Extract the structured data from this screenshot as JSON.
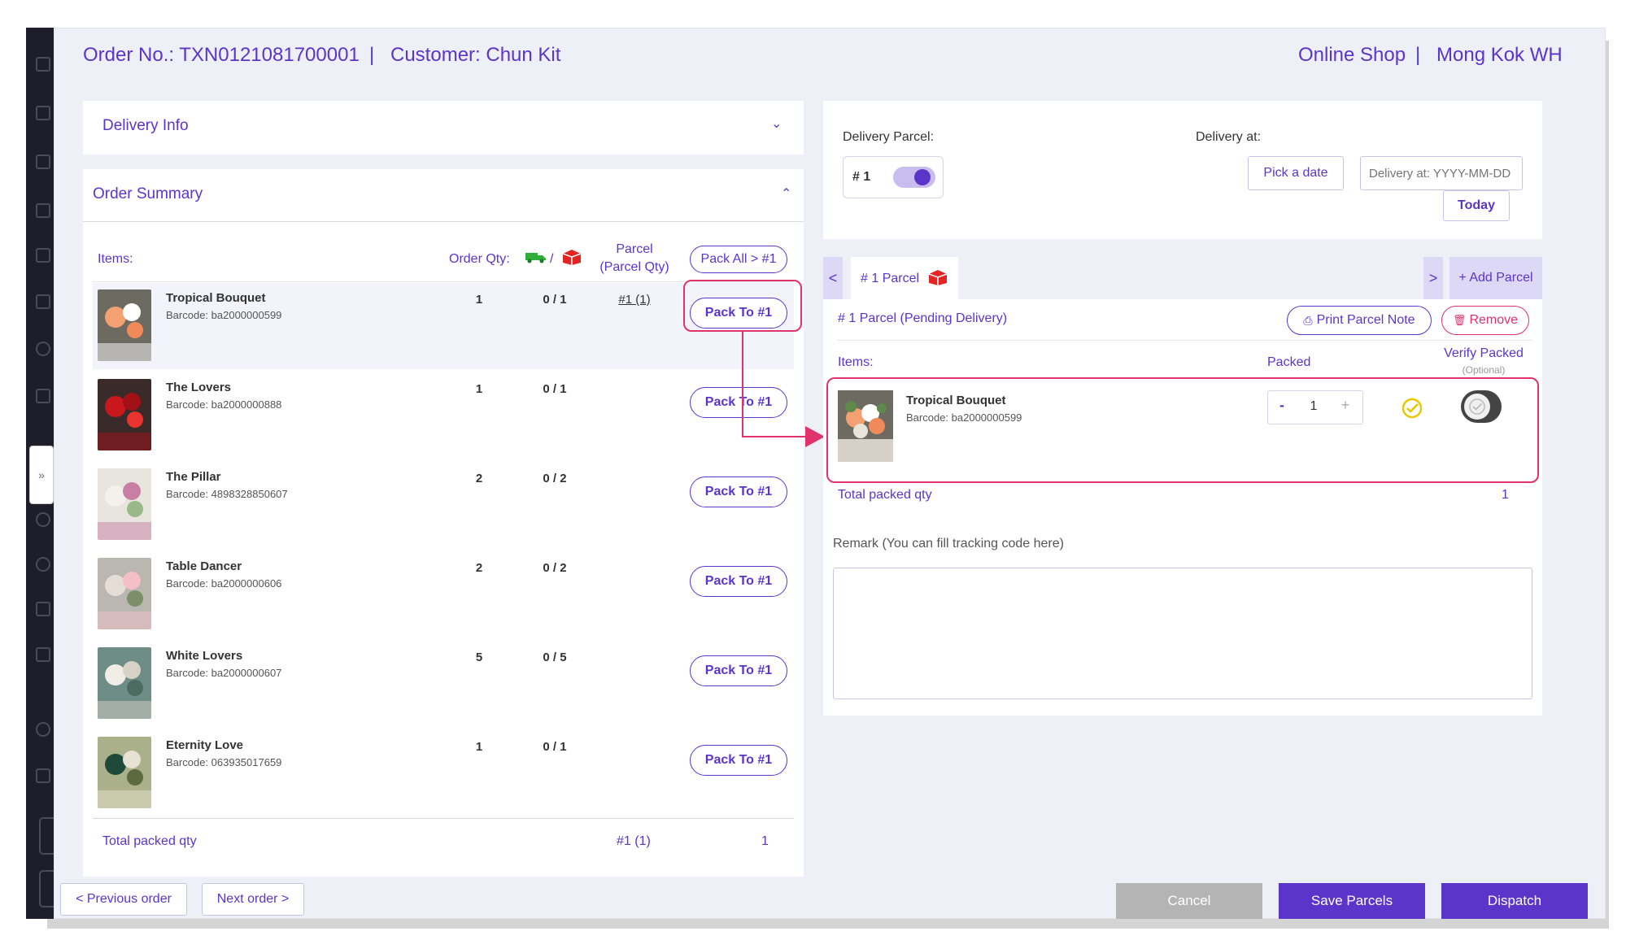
{
  "header": {
    "order_no": "Order No.: TXN0121081700001",
    "sep1": "|",
    "customer": "Customer: Chun Kit",
    "shop": "Online Shop",
    "sep2": "|",
    "warehouse": "Mong Kok WH"
  },
  "delivery_info": {
    "title": "Delivery Info",
    "icon": "chevron-down-icon"
  },
  "order_summary": {
    "title": "Order Summary",
    "icon": "chevron-up-icon",
    "col_items": "Items:",
    "col_order_qty": "Order Qty:",
    "col_slash": "/",
    "col_parcel_line1": "Parcel",
    "col_parcel_line2": "(Parcel Qty)",
    "pack_all": "Pack All > #1",
    "items": [
      {
        "name": "Tropical Bouquet",
        "barcode": "Barcode: ba2000000599",
        "qty": "1",
        "progress": "0 / 1",
        "parcel": "#1 (1)",
        "action": "Pack To #1"
      },
      {
        "name": "The Lovers",
        "barcode": "Barcode: ba2000000888",
        "qty": "1",
        "progress": "0 / 1",
        "parcel": "",
        "action": "Pack To #1"
      },
      {
        "name": "The Pillar",
        "barcode": "Barcode: 4898328850607",
        "qty": "2",
        "progress": "0 / 2",
        "parcel": "",
        "action": "Pack To #1"
      },
      {
        "name": "Table Dancer",
        "barcode": "Barcode: ba2000000606",
        "qty": "2",
        "progress": "0 / 2",
        "parcel": "",
        "action": "Pack To #1"
      },
      {
        "name": "White Lovers",
        "barcode": "Barcode: ba2000000607",
        "qty": "5",
        "progress": "0 / 5",
        "parcel": "",
        "action": "Pack To #1"
      },
      {
        "name": "Eternity Love",
        "barcode": "Barcode: 063935017659",
        "qty": "1",
        "progress": "0 / 1",
        "parcel": "",
        "action": "Pack To #1"
      }
    ],
    "total_label": "Total packed qty",
    "total_parcel": "#1 (1)",
    "total_qty": "1"
  },
  "delivery_panel": {
    "parcel_label": "Delivery Parcel:",
    "parcel_value": "# 1",
    "delivery_at_label": "Delivery at:",
    "pick_date": "Pick a date",
    "date_placeholder": "Delivery at: YYYY-MM-DD",
    "today": "Today"
  },
  "parcel_tabs": {
    "prev": "<",
    "next": ">",
    "tab_label": "# 1 Parcel",
    "add_parcel": "+ Add Parcel"
  },
  "parcel": {
    "title": "# 1 Parcel (Pending Delivery)",
    "print": "Print Parcel Note",
    "remove": "Remove",
    "col_items": "Items:",
    "col_packed": "Packed",
    "col_verify": "Verify Packed",
    "col_verify_sub": "(Optional)",
    "item_name": "Tropical Bouquet",
    "item_barcode": "Barcode: ba2000000599",
    "minus": "-",
    "packed_qty": "1",
    "plus": "+",
    "total_label": "Total packed qty",
    "total_qty": "1",
    "remark_label": "Remark (You can fill tracking code here)"
  },
  "footer": {
    "prev_order": "< Previous order",
    "next_order": "Next order >",
    "cancel": "Cancel",
    "save": "Save Parcels",
    "dispatch": "Dispatch"
  },
  "colors": {
    "accent": "#5b35c9",
    "highlight": "#e0336c",
    "success": "#e6c800",
    "truck": "#2fae3a",
    "box": "#e12424"
  }
}
